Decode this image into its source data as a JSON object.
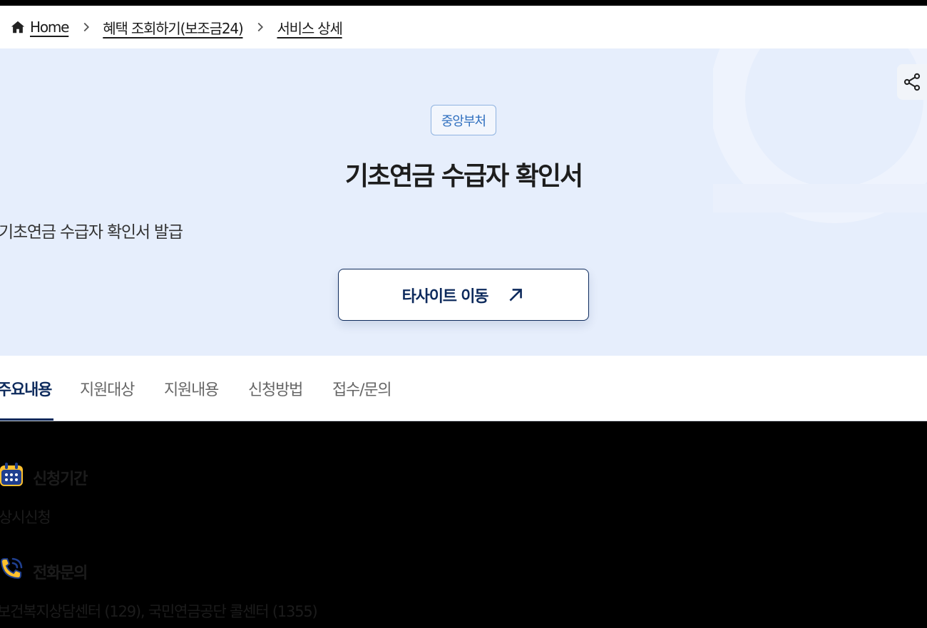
{
  "breadcrumb": {
    "items": [
      "Home",
      "혜택 조회하기(보조금24)",
      "서비스 상세"
    ]
  },
  "hero": {
    "badge": "중앙부처",
    "title": "기초연금 수급자 확인서",
    "description": "기초연금 수급자 확인서 발급",
    "external_button_label": "타사이트 이동"
  },
  "tabs": [
    {
      "label": "주요내용",
      "active": true
    },
    {
      "label": "지원대상",
      "active": false
    },
    {
      "label": "지원내용",
      "active": false
    },
    {
      "label": "신청방법",
      "active": false
    },
    {
      "label": "접수/문의",
      "active": false
    }
  ],
  "sections": {
    "apply_period": {
      "title": "신청기간",
      "text": "상시신청"
    },
    "phone_inquiry": {
      "title": "전화문의",
      "text": "보건복지상담센터 (129), 국민연금공단 콜센터 (1355)"
    }
  },
  "icons": {
    "home": "home-icon",
    "separator": "chevron-right-icon",
    "share": "share-icon",
    "external": "arrow-up-right-icon",
    "calendar": "calendar-icon",
    "phone": "phone-icon"
  },
  "colors": {
    "primary": "#0d2a5c",
    "hero_bg": "#e6eefc",
    "badge": "#2f6fbf",
    "icon_yellow": "#ffc12e",
    "icon_navy": "#1f3f8f"
  }
}
